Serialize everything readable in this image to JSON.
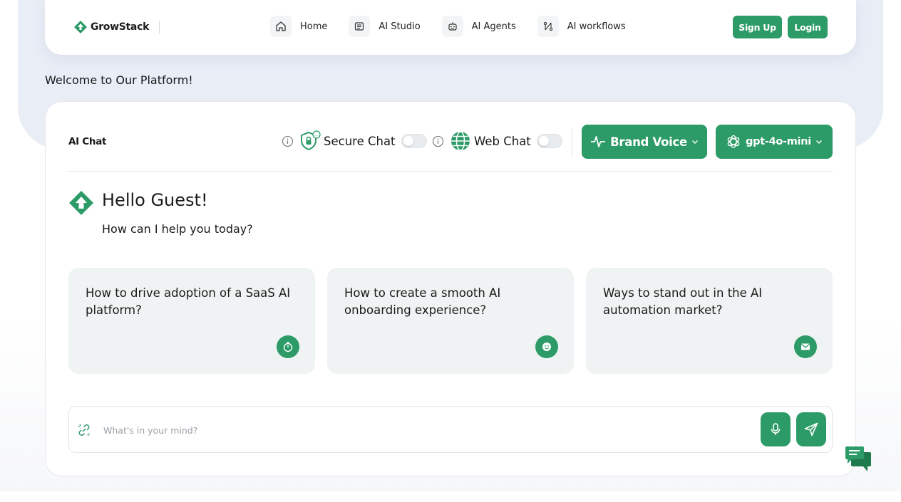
{
  "brand": {
    "name": "GrowStack",
    "accent_color": "#2c9b67"
  },
  "nav": {
    "items": [
      {
        "label": "Home",
        "icon": "home-icon"
      },
      {
        "label": "AI Studio",
        "icon": "studio-icon"
      },
      {
        "label": "AI Agents",
        "icon": "robot-icon"
      },
      {
        "label": "AI workflows",
        "icon": "workflow-icon"
      }
    ],
    "signup_label": "Sign Up",
    "login_label": "Login"
  },
  "welcome": "Welcome to Our Platform!",
  "chat": {
    "title": "AI Chat",
    "secure_chat_label": "Secure Chat",
    "secure_chat_on": false,
    "web_chat_label": "Web Chat",
    "web_chat_on": false,
    "brand_voice_label": "Brand Voice",
    "model_label": "gpt-4o-mini"
  },
  "greeting": {
    "title": "Hello Guest!",
    "subtitle": "How can I help you today?"
  },
  "suggestions": [
    {
      "text": "How to drive adoption of a SaaS AI platform?",
      "icon": "stopwatch-icon"
    },
    {
      "text": "How to create a smooth AI onboarding experience?",
      "icon": "smiley-icon"
    },
    {
      "text": "Ways to stand out in the AI automation market?",
      "icon": "mail-icon"
    }
  ],
  "input": {
    "placeholder": "What's in your mind?",
    "value": ""
  }
}
